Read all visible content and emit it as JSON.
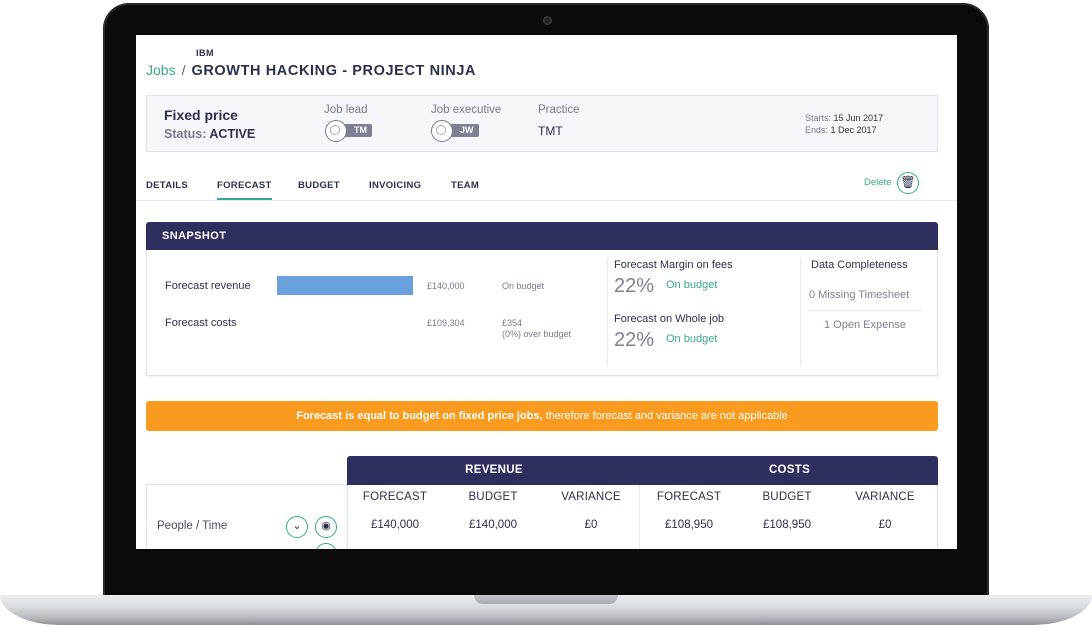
{
  "header": {
    "client": "IBM",
    "breadcrumb_jobs": "Jobs",
    "breadcrumb_sep": "/",
    "title": "GROWTH HACKING - PROJECT NINJA"
  },
  "info": {
    "pricing": "Fixed price",
    "status_label": "Status:",
    "status_value": "ACTIVE",
    "job_lead_label": "Job lead",
    "job_lead_initials": "TM",
    "job_exec_label": "Job executive",
    "job_exec_initials": "JW",
    "practice_label": "Practice",
    "practice_value": "TMT",
    "starts_label": "Starts:",
    "starts_value": "15 Jun 2017",
    "ends_label": "Ends:",
    "ends_value": "1 Dec 2017"
  },
  "tabs": [
    "DETAILS",
    "FORECAST",
    "BUDGET",
    "INVOICING",
    "TEAM"
  ],
  "active_tab": "FORECAST",
  "delete_label": "Delete",
  "snapshot": {
    "title": "SNAPSHOT",
    "rev_label": "Forecast revenue",
    "rev_value": "£140,000",
    "rev_status": "On budget",
    "cost_label": "Forecast costs",
    "cost_value": "£109,304",
    "cost_over": "£354",
    "cost_over_note": "(0%) over budget",
    "margin_fees_label": "Forecast Margin on fees",
    "margin_fees_pct": "22%",
    "margin_fees_status": "On budget",
    "whole_job_label": "Forecast on Whole job",
    "whole_job_pct": "22%",
    "whole_job_status": "On budget",
    "dc_title": "Data Completeness",
    "dc_item1": "0 Missing Timesheet",
    "dc_item2": "1 Open Expense"
  },
  "banner": {
    "bold": "Forecast is equal to budget on fixed price jobs,",
    "rest": " therefore forecast and variance are not applicable"
  },
  "table": {
    "group_revenue": "REVENUE",
    "group_costs": "COSTS",
    "columns": [
      "FORECAST",
      "BUDGET",
      "VARIANCE",
      "FORECAST",
      "BUDGET",
      "VARIANCE"
    ],
    "row_label": "People / Time",
    "row_values": [
      "£140,000",
      "£140,000",
      "£0",
      "£108,950",
      "£108,950",
      "£0"
    ]
  },
  "colors": {
    "accent": "#3aa889",
    "navy": "#2e2f5e",
    "banner": "#f89b1e",
    "bar": "#6aa1dd"
  }
}
